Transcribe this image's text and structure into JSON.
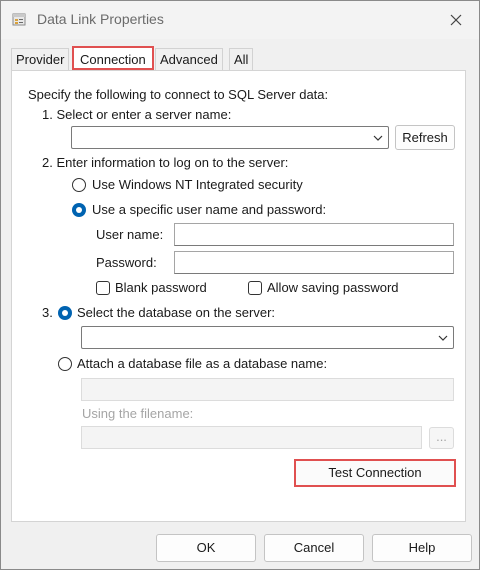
{
  "window": {
    "title": "Data Link Properties"
  },
  "tabs": [
    {
      "label": "Provider",
      "active": false
    },
    {
      "label": "Connection",
      "active": true
    },
    {
      "label": "Advanced",
      "active": false
    },
    {
      "label": "All",
      "active": false
    }
  ],
  "connection": {
    "intro": "Specify the following to connect to SQL Server data:",
    "step1": {
      "label": "1. Select or enter a server name:",
      "server_value": "",
      "refresh_label": "Refresh"
    },
    "step2": {
      "label": "2. Enter information to log on to the server:",
      "windows_auth_label": "Use Windows NT Integrated security",
      "specific_auth_label": "Use a specific user name and password:",
      "selected_auth": "specific",
      "username_label": "User name:",
      "username_value": "",
      "password_label": "Password:",
      "password_value": "",
      "blank_password_label": "Blank password",
      "allow_saving_label": "Allow saving password"
    },
    "step3": {
      "number": "3.",
      "select_db_label": "Select the database on the server:",
      "database_value": "",
      "attach_label": "Attach a database file as a database name:",
      "attach_value": "",
      "filename_label": "Using the filename:",
      "filename_value": "",
      "browse_label": "...",
      "selected_option": "select"
    },
    "test_connection_label": "Test Connection"
  },
  "footer": {
    "ok_label": "OK",
    "cancel_label": "Cancel",
    "help_label": "Help"
  },
  "colors": {
    "accent": "#0063b1",
    "highlight_border": "#e05050",
    "disabled_text": "#a5a5a5"
  },
  "icons": {
    "app": "data-link-icon",
    "close": "close-icon",
    "dropdown": "chevron-down-icon"
  }
}
